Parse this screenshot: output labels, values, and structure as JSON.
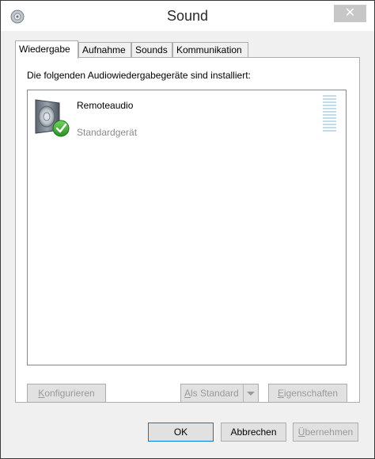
{
  "window": {
    "title": "Sound",
    "close_glyph": "✕"
  },
  "tabs": [
    {
      "label": "Wiedergabe",
      "active": true
    },
    {
      "label": "Aufnahme",
      "active": false
    },
    {
      "label": "Sounds",
      "active": false
    },
    {
      "label": "Kommunikation",
      "active": false
    }
  ],
  "playback": {
    "description": "Die folgenden Audiowiedergabegeräte sind installiert:",
    "devices": [
      {
        "name": "Remoteaudio",
        "status": "Standardgerät",
        "icon": "speaker-icon",
        "badge": "default-check-icon"
      }
    ]
  },
  "panel_buttons": {
    "configure_first": "K",
    "configure_rest": "onfigurieren",
    "set_default_first": "A",
    "set_default_rest": "ls Standard",
    "properties_first": "E",
    "properties_rest": "igenschaften"
  },
  "dialog_buttons": {
    "ok": "OK",
    "cancel": "Abbrechen",
    "apply_first": "Ü",
    "apply_rest": "bernehmen"
  },
  "colors": {
    "accent_check": "#3aa335",
    "level_meter": "#c2dcec",
    "disabled_text": "#9a9a9a"
  }
}
